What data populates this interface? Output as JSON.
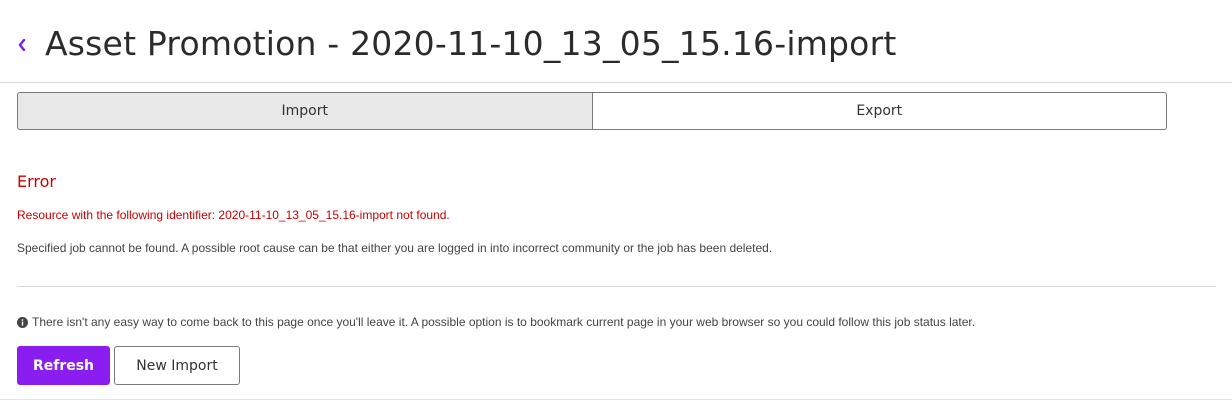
{
  "header": {
    "title": "Asset Promotion - 2020-11-10_13_05_15.16-import",
    "back_icon": "chevron-left-icon",
    "accent_color": "#7b1fe0"
  },
  "tabs": [
    {
      "label": "Import",
      "selected": true
    },
    {
      "label": "Export",
      "selected": false
    }
  ],
  "error": {
    "heading": "Error",
    "message": "Resource with the following identifier: 2020-11-10_13_05_15.16-import not found.",
    "detail": "Specified job cannot be found. A possible root cause can be that either you are logged in into incorrect community or the job has been deleted.",
    "color": "#cc0000"
  },
  "info": {
    "icon": "info-icon",
    "text": "There isn't any easy way to come back to this page once you'll leave it. A possible option is to bookmark current page in your web browser so you could follow this job status later."
  },
  "actions": {
    "refresh_label": "Refresh",
    "new_import_label": "New Import",
    "primary_color": "#8a1ef0"
  }
}
